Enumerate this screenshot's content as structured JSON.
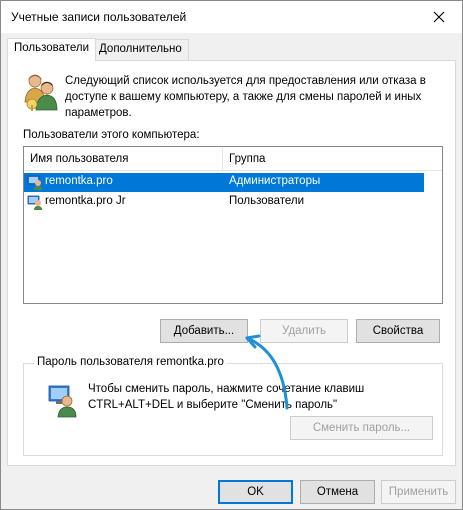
{
  "window": {
    "title": "Учетные записи пользователей"
  },
  "tabs": [
    {
      "label": "Пользователи",
      "active": true
    },
    {
      "label": "Дополнительно",
      "active": false
    }
  ],
  "info": {
    "text": "Следующий список используется для предоставления или отказа в доступе к вашему компьютеру, а также для смены паролей и иных параметров."
  },
  "users_list": {
    "label": "Пользователи этого компьютера:",
    "columns": [
      "Имя пользователя",
      "Группа"
    ],
    "rows": [
      {
        "user": "remontka.pro",
        "group": "Администраторы",
        "selected": true
      },
      {
        "user": "remontka.pro Jr",
        "group": "Пользователи",
        "selected": false
      }
    ]
  },
  "list_buttons": {
    "add": "Добавить...",
    "remove": "Удалить",
    "properties": "Свойства"
  },
  "password_group": {
    "title": "Пароль пользователя remontka.pro",
    "text": "Чтобы сменить пароль, нажмите сочетание клавиш CTRL+ALT+DEL и выберите \"Сменить пароль\"",
    "button": "Сменить пароль..."
  },
  "dialog_buttons": {
    "ok": "OK",
    "cancel": "Отмена",
    "apply": "Применить"
  },
  "colors": {
    "selection": "#0078d7",
    "annotation_arrow": "#1e90d6"
  }
}
